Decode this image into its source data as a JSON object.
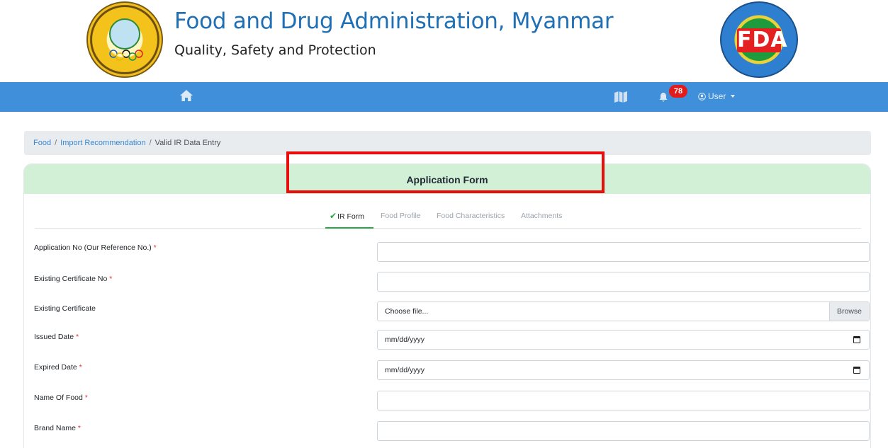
{
  "header": {
    "title": "Food and Drug Administration, Myanmar",
    "subtitle": "Quality, Safety and Protection",
    "left_logo": "ministry-of-health-and-sports-emblem",
    "right_logo_text": "FDA"
  },
  "navbar": {
    "background": "#3f8fdb",
    "home_icon": "home-icon",
    "book_icon": "book-map-icon",
    "bell_icon": "bell-icon",
    "notification_count": "78",
    "user_label": "User"
  },
  "breadcrumb": {
    "items": [
      "Food",
      "Import Recommendation"
    ],
    "active": "Valid IR Data Entry",
    "separator": "/"
  },
  "card": {
    "header_title": "Application Form",
    "header_color": "#d2f0d6",
    "tabs": [
      {
        "label": "IR Form",
        "active": true
      },
      {
        "label": "Food Profile",
        "active": false
      },
      {
        "label": "Food Characteristics",
        "active": false
      },
      {
        "label": "Attachments",
        "active": false
      }
    ]
  },
  "form": {
    "required_mark": "*",
    "fields": [
      {
        "label": "Application No (Our Reference No.)",
        "required": true,
        "type": "text",
        "value": ""
      },
      {
        "label": "Existing Certificate No",
        "required": true,
        "type": "text",
        "value": ""
      },
      {
        "label": "Existing Certificate",
        "required": false,
        "type": "file",
        "placeholder": "Choose file...",
        "button": "Browse"
      },
      {
        "label": "Issued Date",
        "required": true,
        "type": "date",
        "placeholder": "mm/dd/yyyy"
      },
      {
        "label": "Expired Date",
        "required": true,
        "type": "date",
        "placeholder": "mm/dd/yyyy"
      },
      {
        "label": "Name Of Food",
        "required": true,
        "type": "text",
        "value": ""
      },
      {
        "label": "Brand Name",
        "required": true,
        "type": "text",
        "value": ""
      }
    ]
  }
}
